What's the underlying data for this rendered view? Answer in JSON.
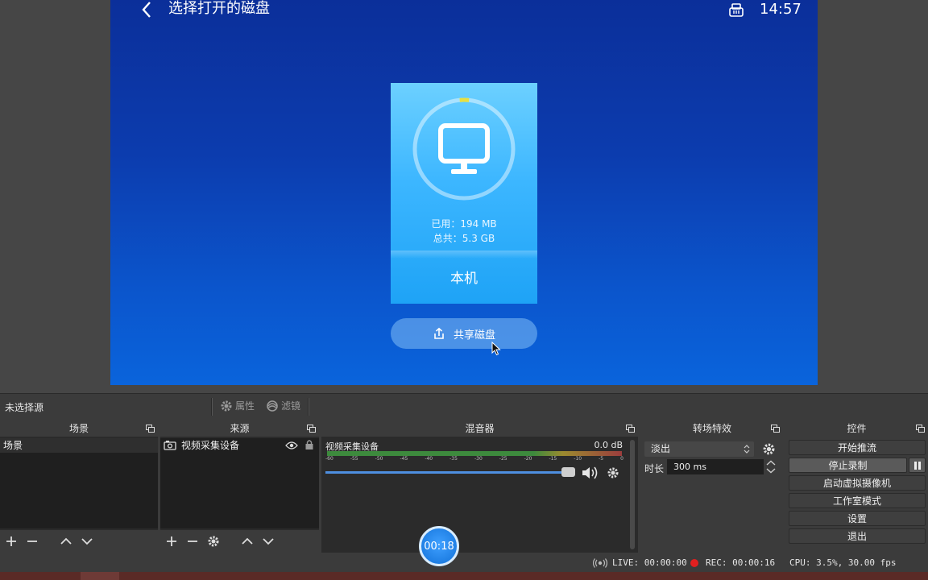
{
  "phone": {
    "title": "选择打开的磁盘",
    "time": "14:57",
    "disk": {
      "used": "已用：194 MB",
      "total": "总共：5.3 GB",
      "name": "本机",
      "usage_fraction": 0.03
    },
    "share_label": "共享磁盘"
  },
  "source_bar": {
    "no_source": "未选择源",
    "properties": "属性",
    "filters": "滤镜"
  },
  "scenes": {
    "title": "场景",
    "items": [
      "场景"
    ]
  },
  "sources": {
    "title": "来源",
    "items": [
      "视频采集设备"
    ]
  },
  "mixer": {
    "title": "混音器",
    "channel": "视频采集设备",
    "db": "0.0 dB",
    "ticks": [
      "-60",
      "-55",
      "-50",
      "-45",
      "-40",
      "-35",
      "-30",
      "-25",
      "-20",
      "-15",
      "-10",
      "-5",
      "0"
    ],
    "volume_fraction": 1.0
  },
  "transitions": {
    "title": "转场特效",
    "selected": "淡出",
    "duration_label": "时长",
    "duration_value": "300 ms"
  },
  "controls": {
    "title": "控件",
    "buttons": [
      "开始推流",
      "停止录制",
      "启动虚拟摄像机",
      "工作室模式",
      "设置",
      "退出"
    ]
  },
  "status": {
    "live": "LIVE: 00:00:00",
    "rec": "REC: 00:00:16",
    "cpu": "CPU: 3.5%, 30.00 fps"
  },
  "timer": "00:18",
  "colors": {
    "accent": "#4e8fe0",
    "rec": "#e02020",
    "card_top": "#6cd0ff",
    "card_bottom": "#1ea3f6"
  }
}
